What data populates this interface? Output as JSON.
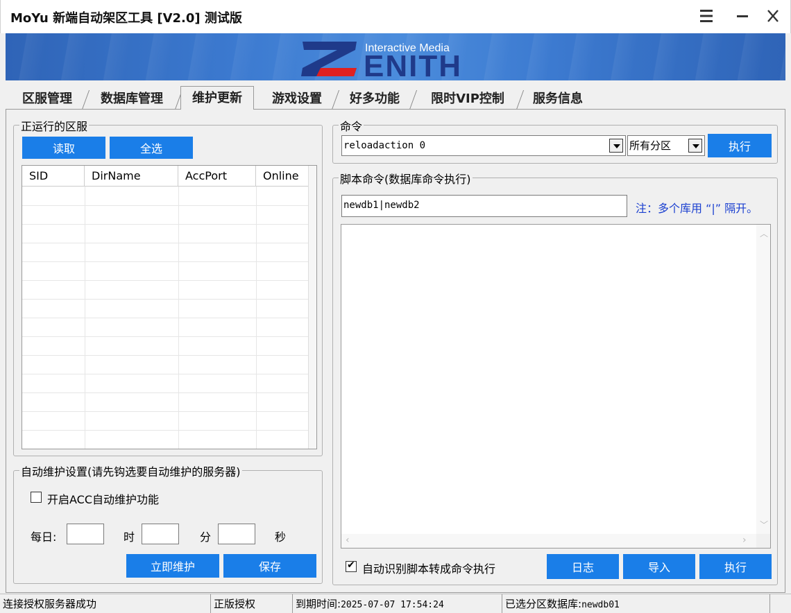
{
  "window": {
    "title": "MoYu 新端自动架区工具 [V2.0] 测试版",
    "menu_icon": "hamburger-icon",
    "minimize_icon": "minimize-icon",
    "close_icon": "close-icon"
  },
  "banner": {
    "logo_subtitle": "Interactive Media",
    "logo_main": "ENITH",
    "logo_letter": "Z",
    "colors": {
      "banner_blue": "#3c7ad0",
      "logo_dark_blue": "#1f3a8a",
      "logo_red": "#e02020"
    }
  },
  "tabs": [
    {
      "label": "区服管理",
      "active": false
    },
    {
      "label": "数据库管理",
      "active": false
    },
    {
      "label": "维护更新",
      "active": true
    },
    {
      "label": "游戏设置",
      "active": false
    },
    {
      "label": "好多功能",
      "active": false
    },
    {
      "label": "限时VIP控制",
      "active": false
    },
    {
      "label": "服务信息",
      "active": false
    }
  ],
  "running_servers": {
    "label": "正运行的区服",
    "read_button": "读取",
    "select_all_button": "全选",
    "columns": [
      "SID",
      "DirName",
      "AccPort",
      "Online"
    ],
    "rows": []
  },
  "auto_maintain": {
    "label": "自动维护设置(请先钩选要自动维护的服务器)",
    "enable_label": "开启ACC自动维护功能",
    "enable_checked": false,
    "daily_label": "每日:",
    "hour_label": "时",
    "minute_label": "分",
    "second_label": "秒",
    "hour_value": "",
    "minute_value": "",
    "second_value": "",
    "maintain_now_button": "立即维护",
    "save_button": "保存"
  },
  "command": {
    "label": "命令",
    "value": "reloadaction 0",
    "zone_selected": "所有分区",
    "execute_button": "执行"
  },
  "script": {
    "label": "脚本命令(数据库命令执行)",
    "db_value": "newdb1|newdb2",
    "note": "注：多个库用 “|” 隔开。",
    "content": "",
    "auto_detect_label": "自动识别脚本转成命令执行",
    "auto_detect_checked": true,
    "log_button": "日志",
    "import_button": "导入",
    "execute_button": "执行",
    "note_color": "#1a3fd0"
  },
  "status": {
    "connection": "连接授权服务器成功",
    "license": "正版授权",
    "expiry_label": "到期时间:",
    "expiry_value": "2025-07-07 17:54:24",
    "selected_db_label": "已选分区数据库:",
    "selected_db_value": "newdb01"
  }
}
